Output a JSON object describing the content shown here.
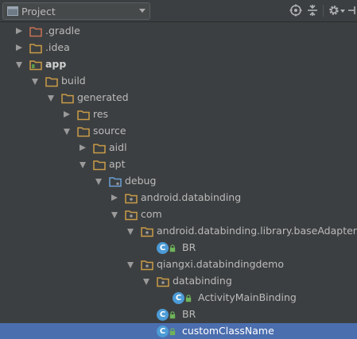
{
  "header": {
    "title": "Project",
    "tools": [
      "globe-target-icon",
      "collapse-all-icon",
      "settings-icon",
      "hide-panel-icon"
    ]
  },
  "colors": {
    "background": "#3c3f41",
    "selection": "#4b6eaf",
    "folder": "#c99c47",
    "class_badge": "#4c9bd6",
    "gradle_folder": "#c87056"
  },
  "tree": [
    {
      "label": ".gradle",
      "expanded": false,
      "icon": "folder-gradle-icon"
    },
    {
      "label": ".idea",
      "expanded": false,
      "icon": "folder-icon"
    },
    {
      "label": "app",
      "expanded": true,
      "icon": "module-folder-icon"
    },
    {
      "label": "build",
      "expanded": true,
      "icon": "folder-icon"
    },
    {
      "label": "generated",
      "expanded": true,
      "icon": "folder-icon"
    },
    {
      "label": "res",
      "expanded": false,
      "icon": "folder-icon"
    },
    {
      "label": "source",
      "expanded": true,
      "icon": "folder-icon"
    },
    {
      "label": "aidl",
      "expanded": false,
      "icon": "folder-icon"
    },
    {
      "label": "apt",
      "expanded": true,
      "icon": "folder-icon"
    },
    {
      "label": "debug",
      "expanded": true,
      "icon": "source-root-folder-icon"
    },
    {
      "label": "android.databinding",
      "expanded": false,
      "icon": "package-icon"
    },
    {
      "label": "com",
      "expanded": true,
      "icon": "package-icon"
    },
    {
      "label": "android.databinding.library.baseAdapters",
      "expanded": true,
      "icon": "package-icon"
    },
    {
      "label": "BR",
      "icon": "class-icon",
      "badge": "C"
    },
    {
      "label": "qiangxi.databindingdemo",
      "expanded": true,
      "icon": "package-icon"
    },
    {
      "label": "databinding",
      "expanded": true,
      "icon": "package-icon"
    },
    {
      "label": "ActivityMainBinding",
      "icon": "class-icon",
      "badge": "C"
    },
    {
      "label": "BR",
      "icon": "class-icon",
      "badge": "C"
    },
    {
      "label": "customClassName",
      "icon": "class-icon",
      "badge": "C",
      "selected": true
    }
  ]
}
